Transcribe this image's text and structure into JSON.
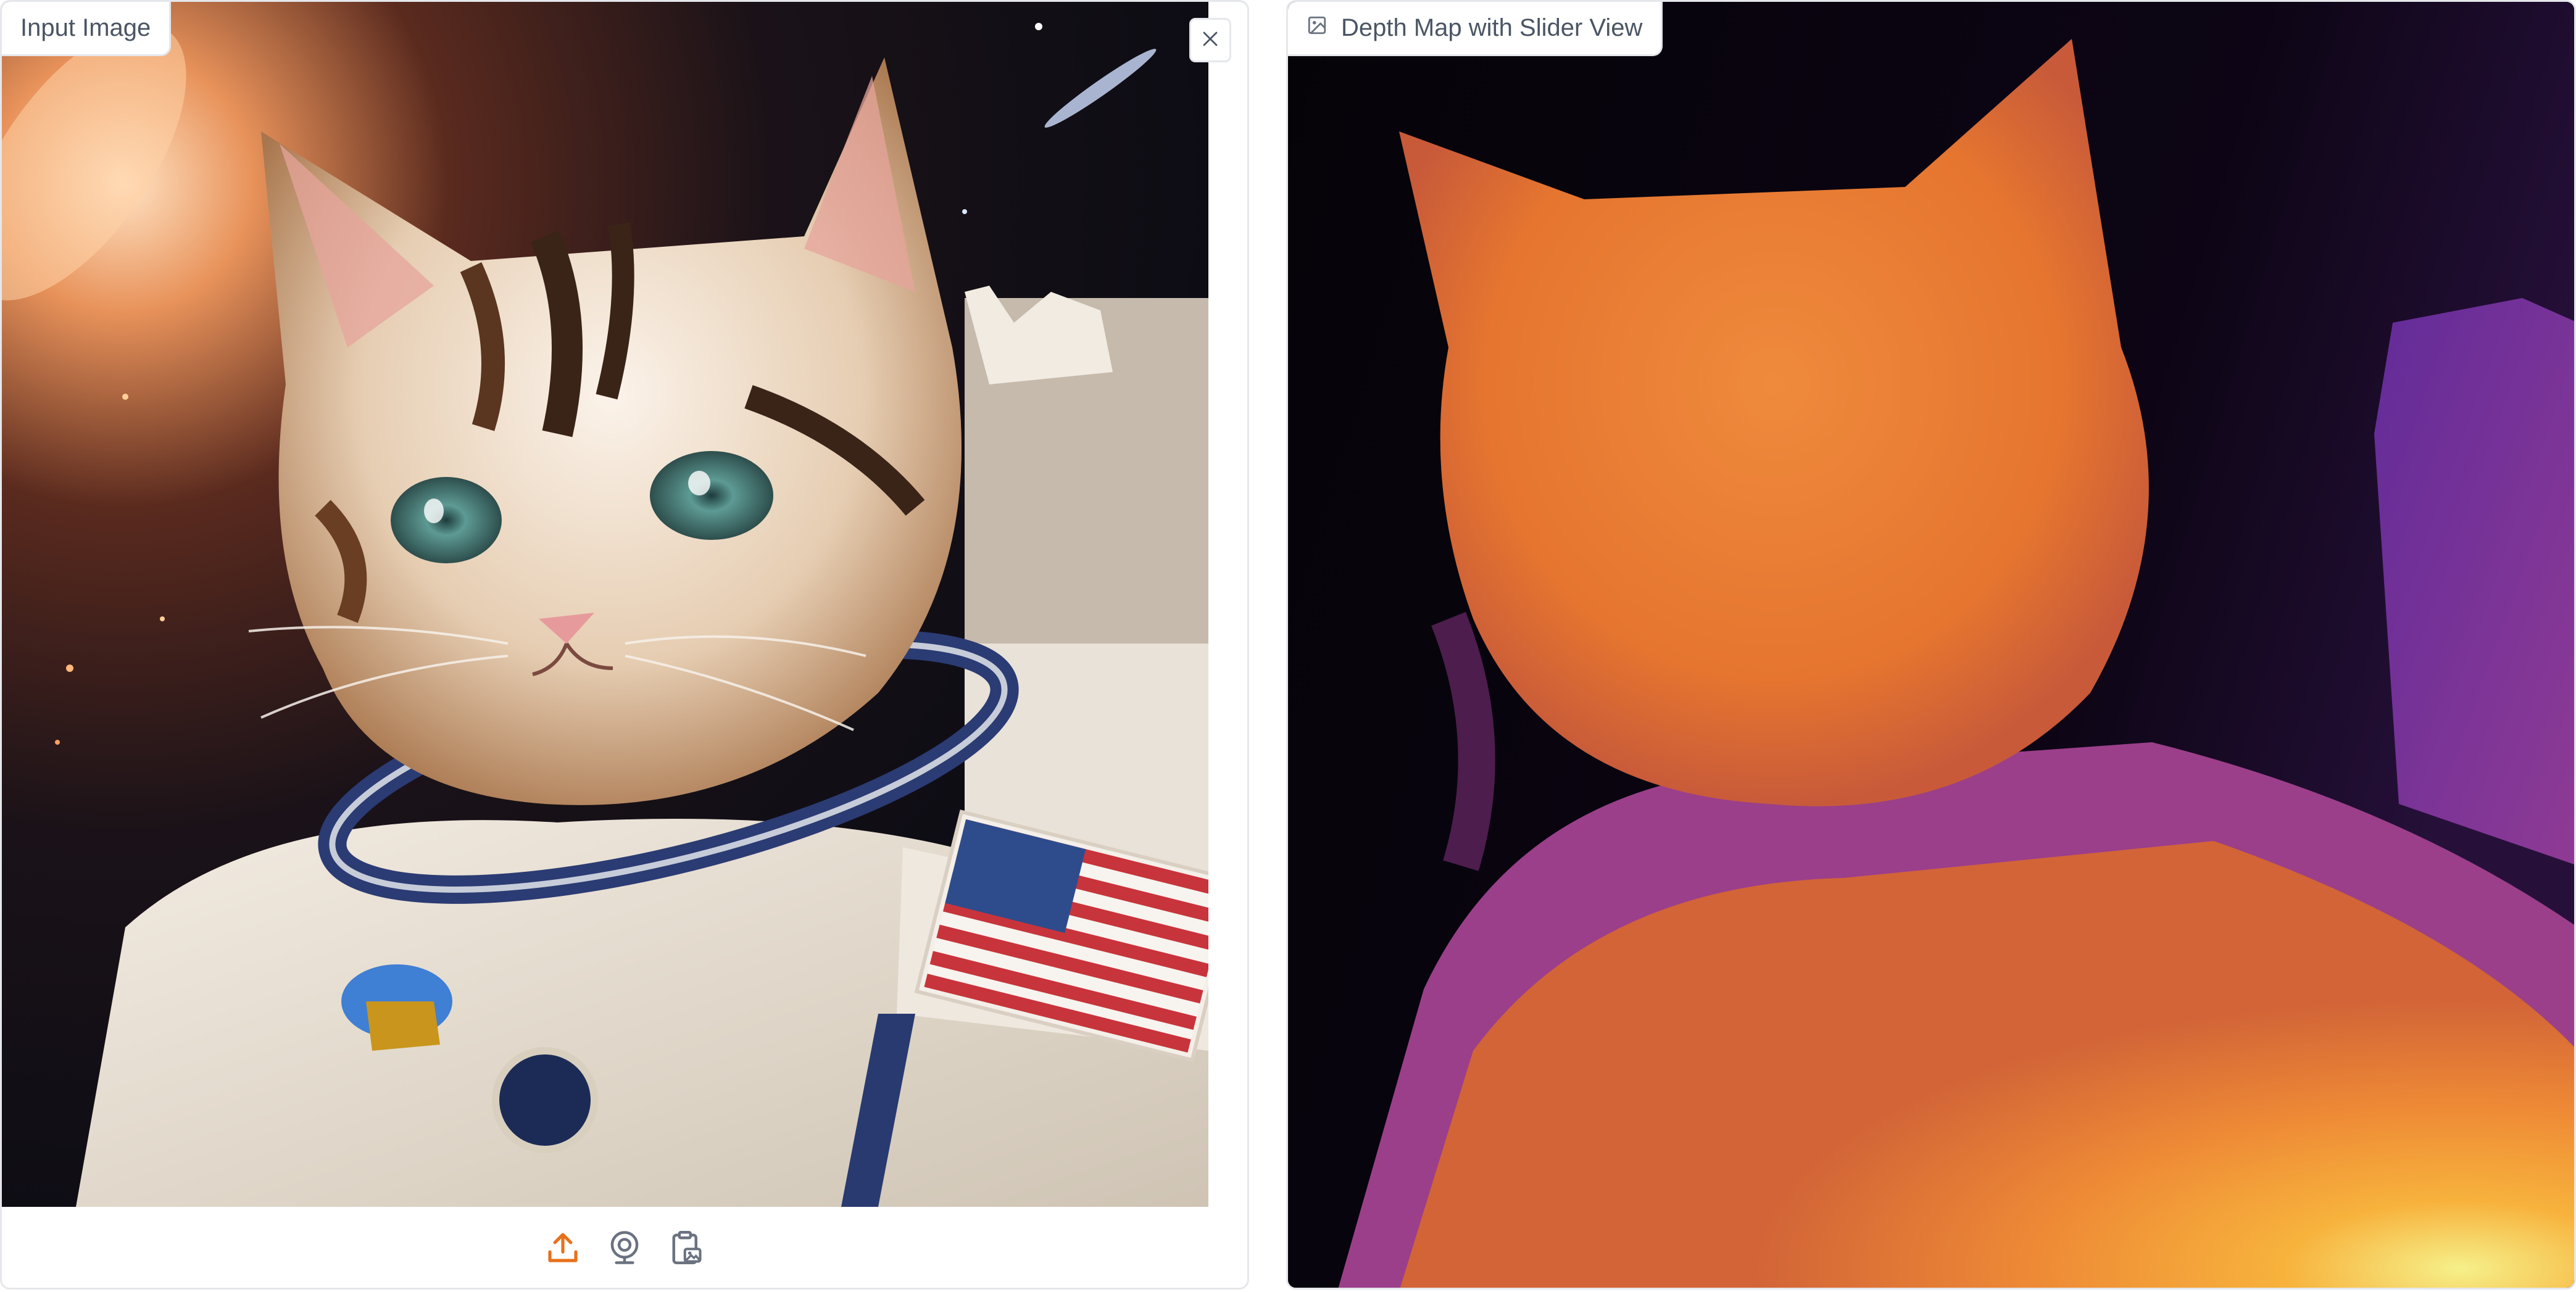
{
  "input_panel": {
    "label": "Input Image",
    "image_alt": "astronaut-cat-photo",
    "close_icon": "close-icon",
    "source_icons": [
      "upload-icon",
      "webcam-icon",
      "clipboard-icon"
    ]
  },
  "depth_panel": {
    "label": "Depth Map with Slider View",
    "label_icon": "image-icon"
  },
  "colors": {
    "accent": "#e8711a",
    "border": "#e5e7eb",
    "label_text": "#4b5563",
    "icon_gray": "#6b7280"
  }
}
